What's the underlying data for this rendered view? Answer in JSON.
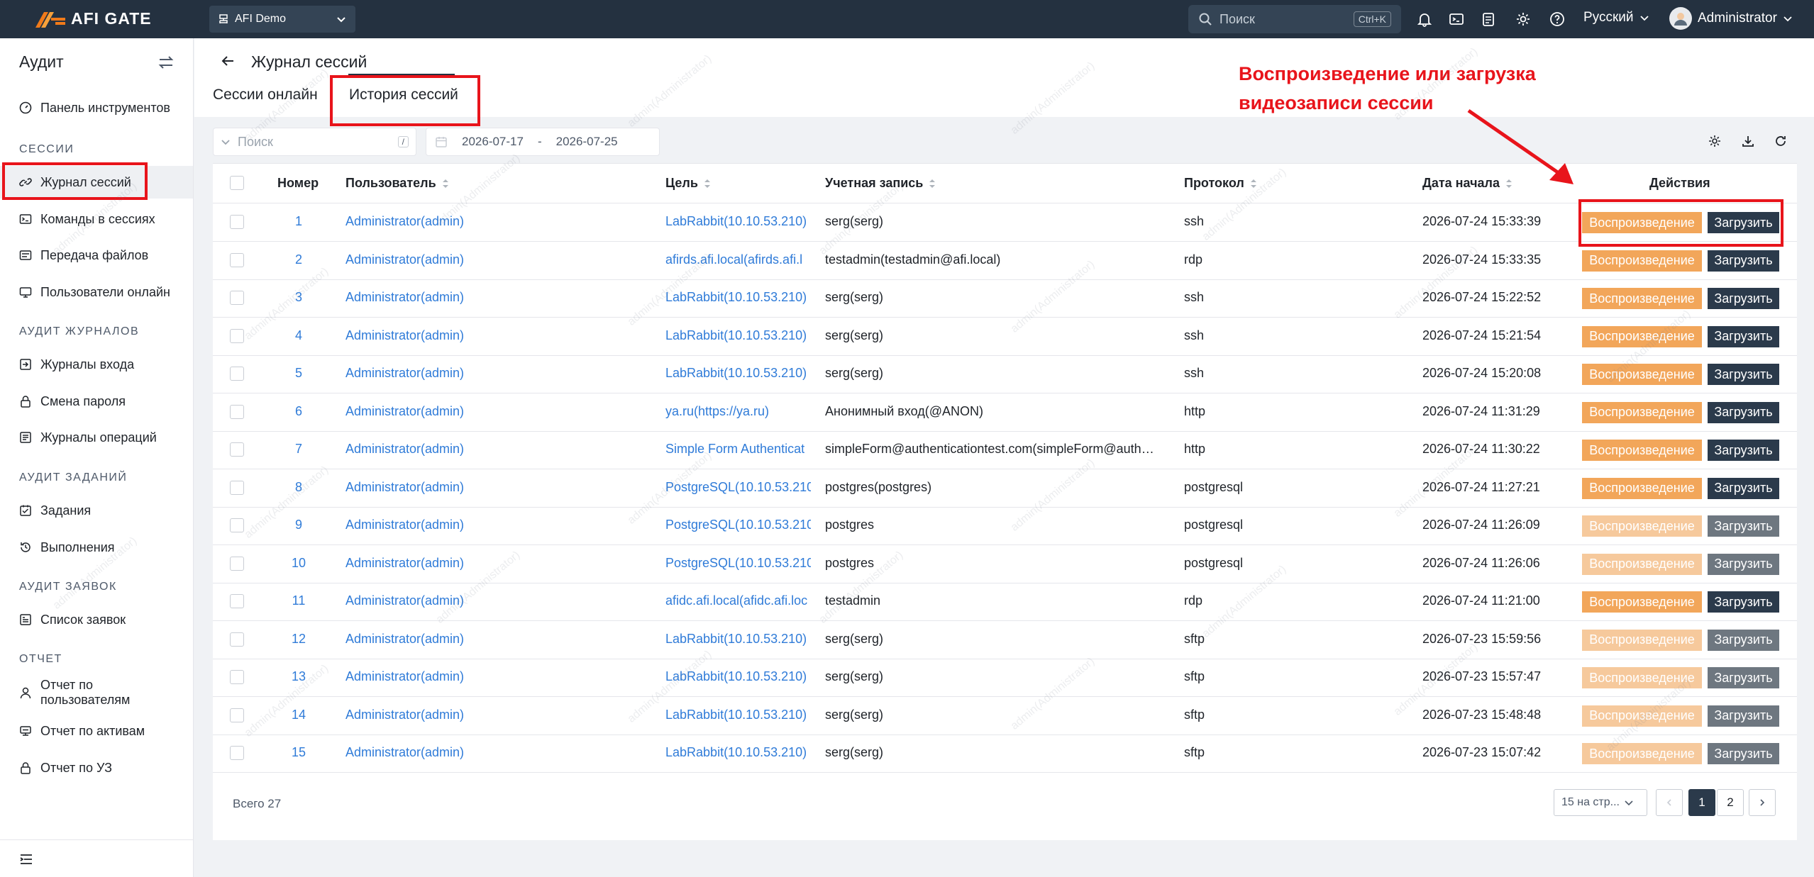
{
  "header": {
    "brand": "AFI GATE",
    "org_selector": "AFI Demo",
    "search_placeholder": "Поиск",
    "search_shortcut": "Ctrl+K",
    "language": "Русский",
    "user": "Administrator"
  },
  "sidebar": {
    "title": "Аудит",
    "dashboard": "Панель инструментов",
    "groups": {
      "sessions": "СЕССИИ",
      "log_audit": "АУДИТ ЖУРНАЛОВ",
      "task_audit": "АУДИТ ЗАДАНИЙ",
      "ticket_audit": "АУДИТ ЗАЯВОК",
      "report": "ОТЧЕТ"
    },
    "items": {
      "session_log": "Журнал сессий",
      "session_commands": "Команды в сессиях",
      "file_transfer": "Передача файлов",
      "online_users": "Пользователи онлайн",
      "login_logs": "Журналы входа",
      "password_change": "Смена пароля",
      "operation_logs": "Журналы операций",
      "tasks": "Задания",
      "executions": "Выполнения",
      "tickets_list": "Список заявок",
      "user_report_l1": "Отчет по",
      "user_report_l2": "пользователям",
      "asset_report": "Отчет по активам",
      "account_report": "Отчет по УЗ"
    }
  },
  "page": {
    "title": "Журнал сессий",
    "tabs": [
      "Сессии онлайн",
      "История сессий"
    ],
    "active_tab": "История сессий",
    "search_placeholder": "Поиск",
    "search_shortcut": "/",
    "date_from": "2026-07-17",
    "date_sep": "-",
    "date_to": "2026-07-25"
  },
  "annotation": {
    "line1": "Воспроизведение или загрузка",
    "line2": "видеозаписи сессии"
  },
  "table": {
    "columns": [
      "Номер",
      "Пользователь",
      "Цель",
      "Учетная запись",
      "Протокол",
      "Дата начала",
      "Действия"
    ],
    "play_label": "Воспроизведение",
    "download_label": "Загрузить",
    "rows": [
      {
        "n": "1",
        "user": "Administrator(admin)",
        "target": "LabRabbit(10.10.53.210)",
        "account": "serg(serg)",
        "protocol": "ssh",
        "date": "2026-07-24 15:33:39",
        "dim": false
      },
      {
        "n": "2",
        "user": "Administrator(admin)",
        "target": "afirds.afi.local(afirds.afi.l",
        "account": "testadmin(testadmin@afi.local)",
        "protocol": "rdp",
        "date": "2026-07-24 15:33:35",
        "dim": false
      },
      {
        "n": "3",
        "user": "Administrator(admin)",
        "target": "LabRabbit(10.10.53.210)",
        "account": "serg(serg)",
        "protocol": "ssh",
        "date": "2026-07-24 15:22:52",
        "dim": false
      },
      {
        "n": "4",
        "user": "Administrator(admin)",
        "target": "LabRabbit(10.10.53.210)",
        "account": "serg(serg)",
        "protocol": "ssh",
        "date": "2026-07-24 15:21:54",
        "dim": false
      },
      {
        "n": "5",
        "user": "Administrator(admin)",
        "target": "LabRabbit(10.10.53.210)",
        "account": "serg(serg)",
        "protocol": "ssh",
        "date": "2026-07-24 15:20:08",
        "dim": false
      },
      {
        "n": "6",
        "user": "Administrator(admin)",
        "target": "ya.ru(https://ya.ru)",
        "account": "Анонимный вход(@ANON)",
        "protocol": "http",
        "date": "2026-07-24 11:31:29",
        "dim": false
      },
      {
        "n": "7",
        "user": "Administrator(admin)",
        "target": "Simple Form Authenticat",
        "account": "simpleForm@authenticationtest.com(simpleForm@auth…",
        "protocol": "http",
        "date": "2026-07-24 11:30:22",
        "dim": false
      },
      {
        "n": "8",
        "user": "Administrator(admin)",
        "target": "PostgreSQL(10.10.53.210",
        "account": "postgres(postgres)",
        "protocol": "postgresql",
        "date": "2026-07-24 11:27:21",
        "dim": false
      },
      {
        "n": "9",
        "user": "Administrator(admin)",
        "target": "PostgreSQL(10.10.53.210",
        "account": "postgres",
        "protocol": "postgresql",
        "date": "2026-07-24 11:26:09",
        "dim": true
      },
      {
        "n": "10",
        "user": "Administrator(admin)",
        "target": "PostgreSQL(10.10.53.210",
        "account": "postgres",
        "protocol": "postgresql",
        "date": "2026-07-24 11:26:06",
        "dim": true
      },
      {
        "n": "11",
        "user": "Administrator(admin)",
        "target": "afidc.afi.local(afidc.afi.loc",
        "account": "testadmin",
        "protocol": "rdp",
        "date": "2026-07-24 11:21:00",
        "dim": false
      },
      {
        "n": "12",
        "user": "Administrator(admin)",
        "target": "LabRabbit(10.10.53.210)",
        "account": "serg(serg)",
        "protocol": "sftp",
        "date": "2026-07-23 15:59:56",
        "dim": true
      },
      {
        "n": "13",
        "user": "Administrator(admin)",
        "target": "LabRabbit(10.10.53.210)",
        "account": "serg(serg)",
        "protocol": "sftp",
        "date": "2026-07-23 15:57:47",
        "dim": true
      },
      {
        "n": "14",
        "user": "Administrator(admin)",
        "target": "LabRabbit(10.10.53.210)",
        "account": "serg(serg)",
        "protocol": "sftp",
        "date": "2026-07-23 15:48:48",
        "dim": true
      },
      {
        "n": "15",
        "user": "Administrator(admin)",
        "target": "LabRabbit(10.10.53.210)",
        "account": "serg(serg)",
        "protocol": "sftp",
        "date": "2026-07-23 15:07:42",
        "dim": true
      }
    ]
  },
  "pagination": {
    "total": "Всего 27",
    "page_size": "15 на стр...",
    "pages": [
      "1",
      "2"
    ],
    "current": "1"
  },
  "watermark": "admin(Administrator)",
  "colors": {
    "header_bg": "#243140",
    "accent_orange": "#f2a65a",
    "link": "#2f7bd8",
    "annotation_red": "#e8141b"
  }
}
